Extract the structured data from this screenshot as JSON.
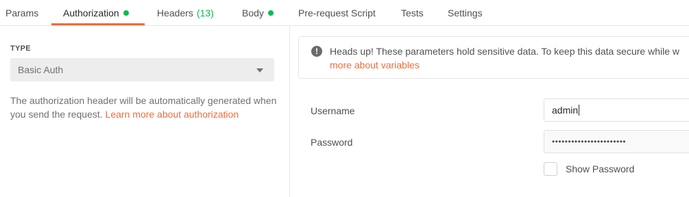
{
  "tabs": [
    {
      "label": "Params"
    },
    {
      "label": "Authorization",
      "indicator": "green-dot"
    },
    {
      "label": "Headers",
      "count": "(13)"
    },
    {
      "label": "Body",
      "indicator": "green-dot"
    },
    {
      "label": "Pre-request Script"
    },
    {
      "label": "Tests"
    },
    {
      "label": "Settings"
    }
  ],
  "active_tab": "Authorization",
  "auth": {
    "type_label": "TYPE",
    "selected_type": "Basic Auth",
    "description": "The authorization header will be automatically generated when you send the request. ",
    "learn_more_link": "Learn more about authorization"
  },
  "alert": {
    "icon": "exclamation-circle-icon",
    "text": "Heads up! These parameters hold sensitive data. To keep this data secure while w",
    "link": "more about variables"
  },
  "fields": {
    "username_label": "Username",
    "username_value": "admin",
    "password_label": "Password",
    "password_mask": "•••••••••••••••••••••••",
    "show_password_label": "Show Password",
    "show_password_checked": false
  },
  "colors": {
    "accent": "#ef6c3a",
    "indicator_green": "#0cbb52",
    "border": "#e6e6e6",
    "select_bg": "#ededed"
  }
}
